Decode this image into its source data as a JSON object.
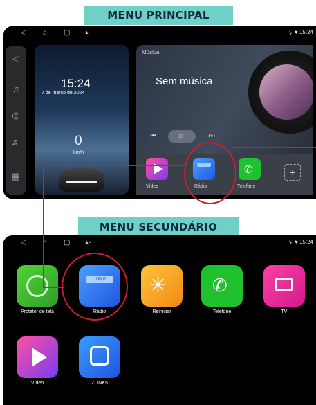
{
  "labels": {
    "main": "MENU PRINCIPAL",
    "secondary": "MENU SECUNDÁRIO"
  },
  "status": {
    "time": "15:24",
    "icons": "⚲ ♥",
    "extra": "▲▪"
  },
  "main": {
    "clock": {
      "time": "15:24",
      "date": "7 de março de 2024",
      "speed": "0",
      "unit": "km/h"
    },
    "media": {
      "category": "Música",
      "title": "Sem música",
      "controls": [
        "⏮",
        "▷",
        "⏭"
      ]
    },
    "apps": [
      {
        "label": "Vídeo",
        "color": "#a63cf0"
      },
      {
        "label": "Rádio",
        "color": "#2d6cf5"
      },
      {
        "label": "Telefone",
        "color": "#1fc12f"
      }
    ]
  },
  "secondary": {
    "apps": [
      {
        "label": "Protetor de tela",
        "color": "#44c22c"
      },
      {
        "label": "Rádio",
        "color": "#2d6cf5"
      },
      {
        "label": "Reiniciar",
        "color": "#f2a516"
      },
      {
        "label": "Telefone",
        "color": "#1fc12f"
      },
      {
        "label": "TV",
        "color": "#e0209a"
      },
      {
        "label": "Vídeo",
        "color": "#a63cf0"
      },
      {
        "label": "ZLINK5",
        "color": "#2d6cf5"
      }
    ],
    "radio_freq": "108.0"
  },
  "accent": "#cc1e2c"
}
